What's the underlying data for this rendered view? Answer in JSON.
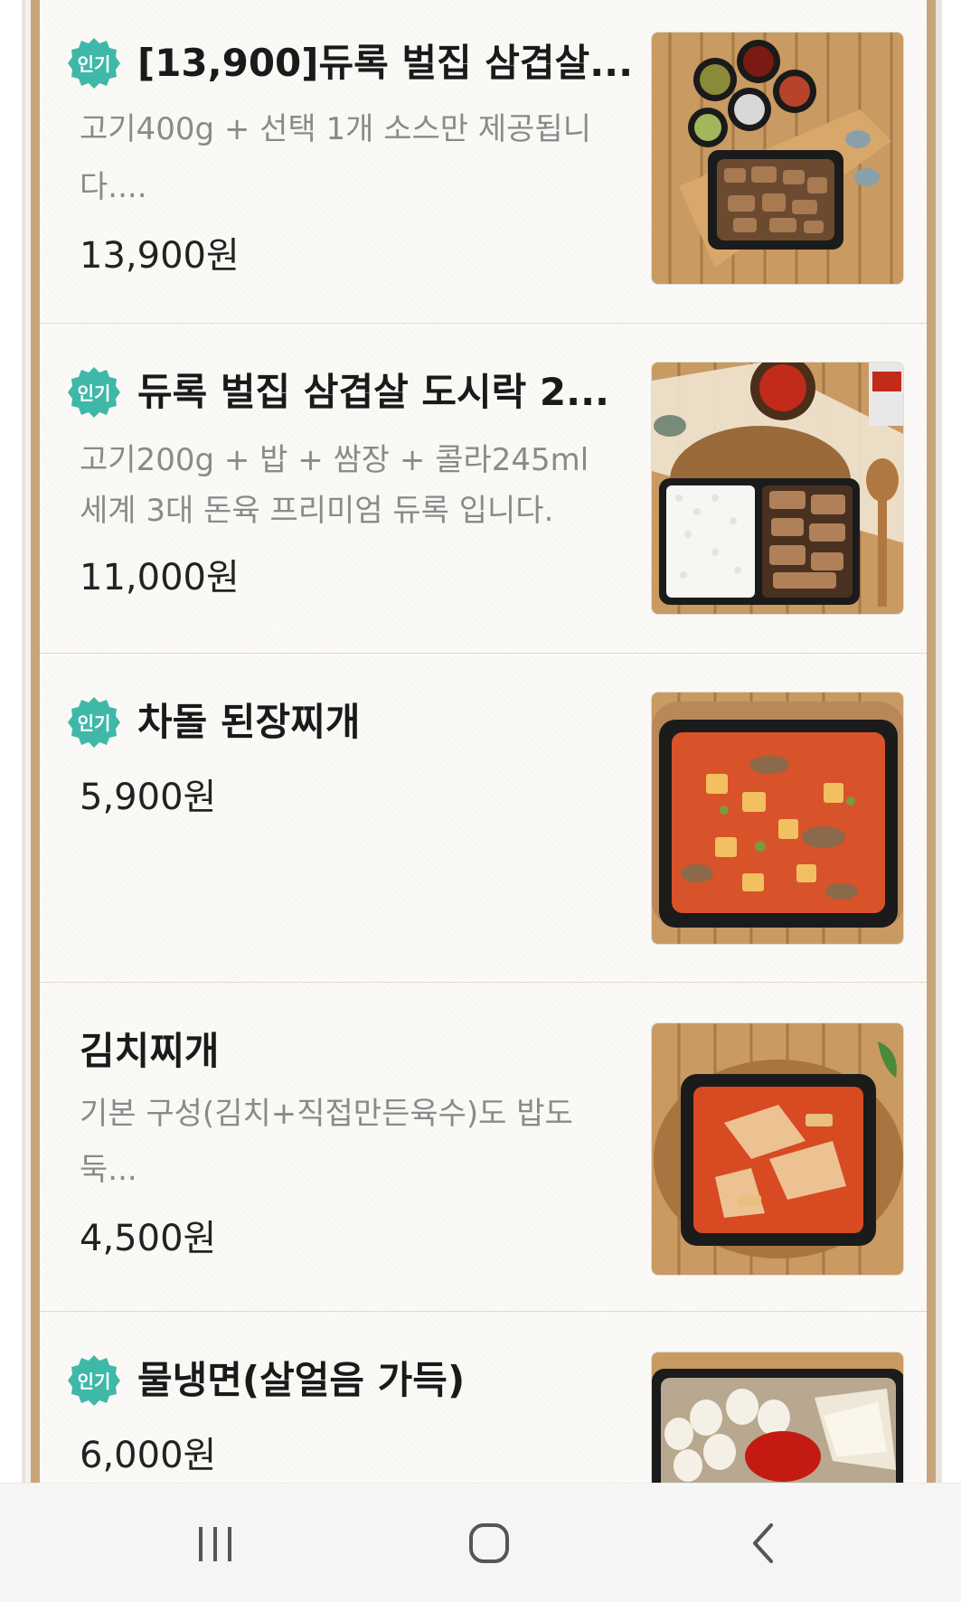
{
  "menu": {
    "badge_label": "인기",
    "items": [
      {
        "title": "[13,900]듀록 벌집 삼겹살...",
        "desc_line1": "고기400g + 선택 1개 소스만 제공됩니",
        "desc_line2": "다....",
        "price": "13,900원",
        "popular": true,
        "image": "grilled-pork-platter-image"
      },
      {
        "title": "듀록 벌집 삼겹살 도시락 2...",
        "desc_line1": "고기200g + 밥 + 쌈장 + 콜라245ml",
        "desc_line2": "세계 3대 돈육 프리미엄 듀록 입니다.",
        "price": "11,000원",
        "popular": true,
        "image": "pork-rice-lunchbox-image"
      },
      {
        "title": "차돌 된장찌개",
        "price": "5,900원",
        "popular": true,
        "image": "soybean-stew-image"
      },
      {
        "title": "김치찌개",
        "desc_line1": "기본 구성(김치+직접만든육수)도 밥도",
        "desc_line2": "둑...",
        "price": "4,500원",
        "popular": false,
        "image": "kimchi-stew-image"
      },
      {
        "title": "물냉면(살얼음 가득)",
        "price": "6,000원",
        "popular": true,
        "image": "cold-noodles-image"
      }
    ]
  },
  "navbar": {
    "recent_apps": "recent-apps-icon",
    "home": "home-icon",
    "back": "back-icon"
  },
  "colors": {
    "badge": "#3fb8a8",
    "border": "#c8a57a"
  }
}
